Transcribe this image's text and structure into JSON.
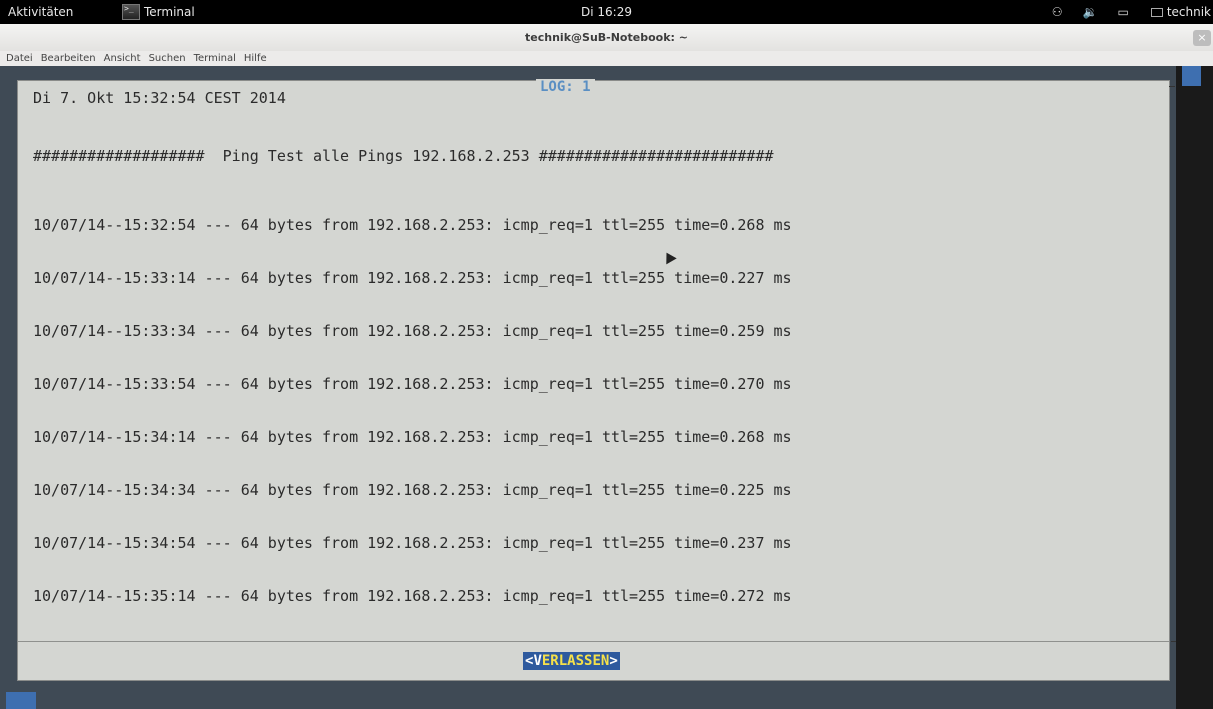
{
  "topbar": {
    "activities": "Aktivitäten",
    "app_name": "Terminal",
    "clock": "Di 16:29",
    "user": "technik"
  },
  "window": {
    "title": "technik@SuB-Notebook: ~",
    "close_symbol": "×",
    "menu": [
      "Datei",
      "Bearbeiten",
      "Ansicht",
      "Suchen",
      "Terminal",
      "Hilfe"
    ]
  },
  "dialog": {
    "title": "LOG: 1",
    "date_line": "Di 7. Okt 15:32:54 CEST 2014",
    "header_line": "###################  Ping Test alle Pings 192.168.2.253 ##########################",
    "log_lines": [
      "10/07/14--15:32:54 --- 64 bytes from 192.168.2.253: icmp_req=1 ttl=255 time=0.268 ms",
      "10/07/14--15:33:14 --- 64 bytes from 192.168.2.253: icmp_req=1 ttl=255 time=0.227 ms",
      "10/07/14--15:33:34 --- 64 bytes from 192.168.2.253: icmp_req=1 ttl=255 time=0.259 ms",
      "10/07/14--15:33:54 --- 64 bytes from 192.168.2.253: icmp_req=1 ttl=255 time=0.270 ms",
      "10/07/14--15:34:14 --- 64 bytes from 192.168.2.253: icmp_req=1 ttl=255 time=0.268 ms",
      "10/07/14--15:34:34 --- 64 bytes from 192.168.2.253: icmp_req=1 ttl=255 time=0.225 ms",
      "10/07/14--15:34:54 --- 64 bytes from 192.168.2.253: icmp_req=1 ttl=255 time=0.237 ms",
      "10/07/14--15:35:14 --- 64 bytes from 192.168.2.253: icmp_req=1 ttl=255 time=0.272 ms"
    ],
    "exit_button": {
      "open": "<",
      "hotkey": "V",
      "rest": "ERLASSEN",
      "close": ">"
    }
  },
  "colors": {
    "terminal_bg": "#3f4a55",
    "dialog_bg": "#d4d6d2",
    "title_blue": "#5a8fc3",
    "button_bg": "#2e5a9e",
    "button_text": "#f5e14a"
  },
  "icons": {
    "accessibility": "accessibility-icon",
    "volume": "volume-icon",
    "network": "network-icon",
    "keyboard": "keyboard-icon",
    "terminal": "terminal-icon"
  }
}
